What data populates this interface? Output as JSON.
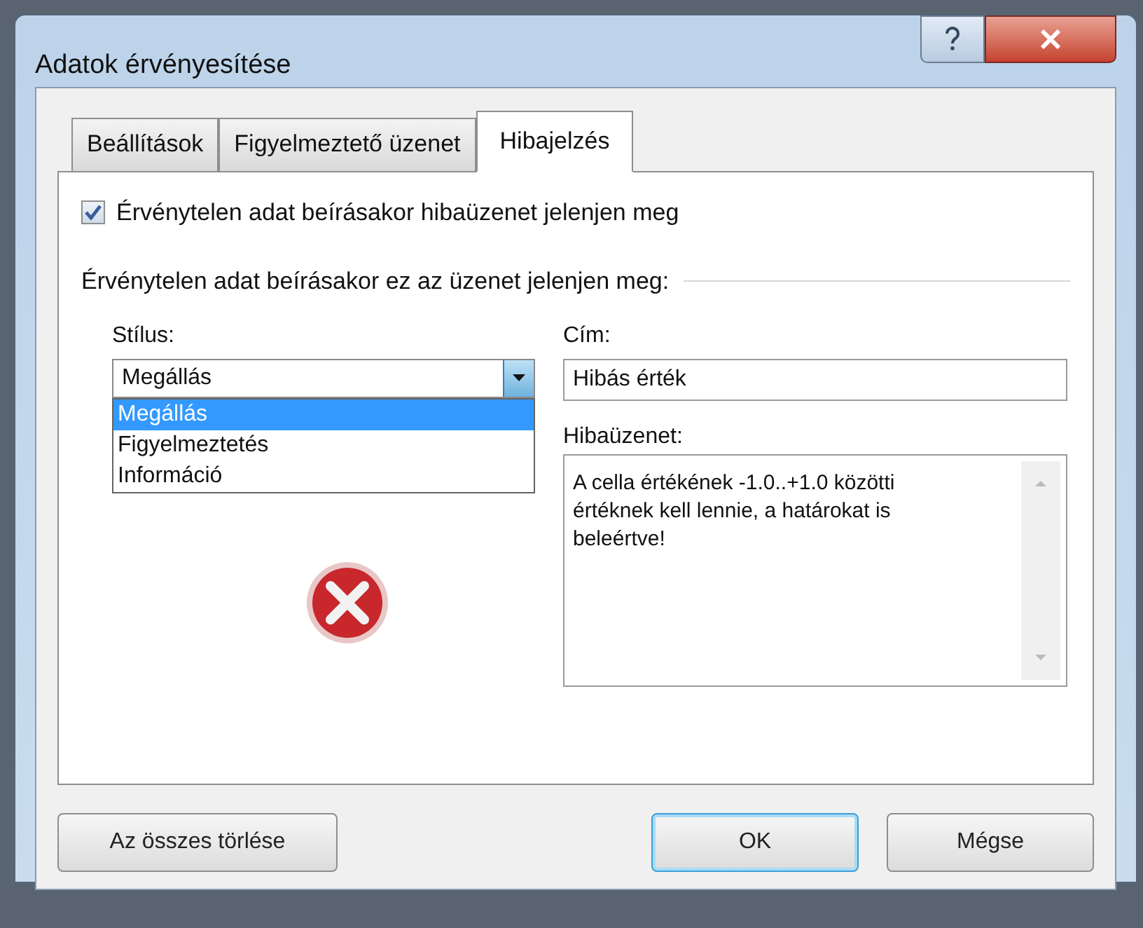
{
  "window": {
    "title": "Adatok érvényesítése"
  },
  "tabs": [
    {
      "label": "Beállítások",
      "selected": false
    },
    {
      "label": "Figyelmeztető üzenet",
      "selected": false
    },
    {
      "label": "Hibajelzés",
      "selected": true
    }
  ],
  "show_error_checkbox": {
    "label": "Érvénytelen adat beírásakor hibaüzenet jelenjen meg",
    "checked": true
  },
  "section_label": "Érvénytelen adat beírásakor ez az üzenet jelenjen meg:",
  "style": {
    "label": "Stílus:",
    "value": "Megállás",
    "expanded": true,
    "options": [
      {
        "label": "Megállás",
        "selected": true
      },
      {
        "label": "Figyelmeztetés",
        "selected": false
      },
      {
        "label": "Információ",
        "selected": false
      }
    ]
  },
  "title_field": {
    "label": "Cím:",
    "value": "Hibás érték"
  },
  "message_field": {
    "label": "Hibaüzenet:",
    "value": "A cella értékének -1.0..+1.0 közötti értéknek kell lennie, a határokat is beleértve!"
  },
  "buttons": [
    {
      "label": "Az összes törlése",
      "kind": "left",
      "default": false
    },
    {
      "label": "OK",
      "kind": "right",
      "default": true
    },
    {
      "label": "Mégse",
      "kind": "right",
      "default": false
    }
  ]
}
